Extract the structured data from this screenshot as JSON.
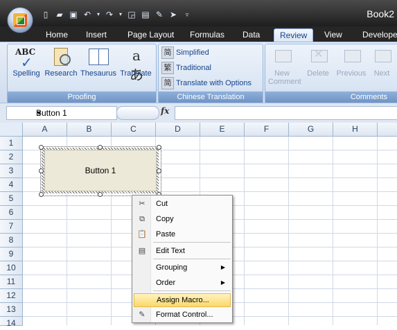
{
  "window": {
    "title": "Book2"
  },
  "ribbon_tabs": [
    "Home",
    "Insert",
    "Page Layout",
    "Formulas",
    "Data",
    "Review",
    "View",
    "Developer"
  ],
  "active_tab": "Review",
  "proofing": {
    "buttons": [
      "Spelling",
      "Research",
      "Thesaurus",
      "Translate"
    ],
    "spelling_icon_text": "ABC",
    "translate_icon_text": "aあ",
    "label": "Proofing"
  },
  "chinese_translation": {
    "buttons": [
      "Simplified",
      "Traditional",
      "Translate with Options"
    ],
    "icons": [
      "简",
      "繁",
      "简"
    ],
    "label": "Chinese Translation"
  },
  "comments": {
    "buttons": [
      "New Comment",
      "Delete",
      "Previous",
      "Next"
    ],
    "label": "Comments"
  },
  "formula_bar": {
    "name_box": "Button 1",
    "fx": "fx",
    "formula": ""
  },
  "columns": [
    "A",
    "B",
    "C",
    "D",
    "E",
    "F",
    "G",
    "H"
  ],
  "rows": [
    "1",
    "2",
    "3",
    "4",
    "5",
    "6",
    "7",
    "8",
    "9",
    "10",
    "11",
    "12",
    "13",
    "14"
  ],
  "form_button": {
    "label": "Button 1"
  },
  "context_menu": {
    "cut": "Cut",
    "copy": "Copy",
    "paste": "Paste",
    "edit_text": "Edit Text",
    "grouping": "Grouping",
    "order": "Order",
    "assign_macro": "Assign Macro...",
    "format_control": "Format Control..."
  },
  "colors": {
    "ribbon_text": "#15428b",
    "menu_highlight": "#fbd86b"
  }
}
